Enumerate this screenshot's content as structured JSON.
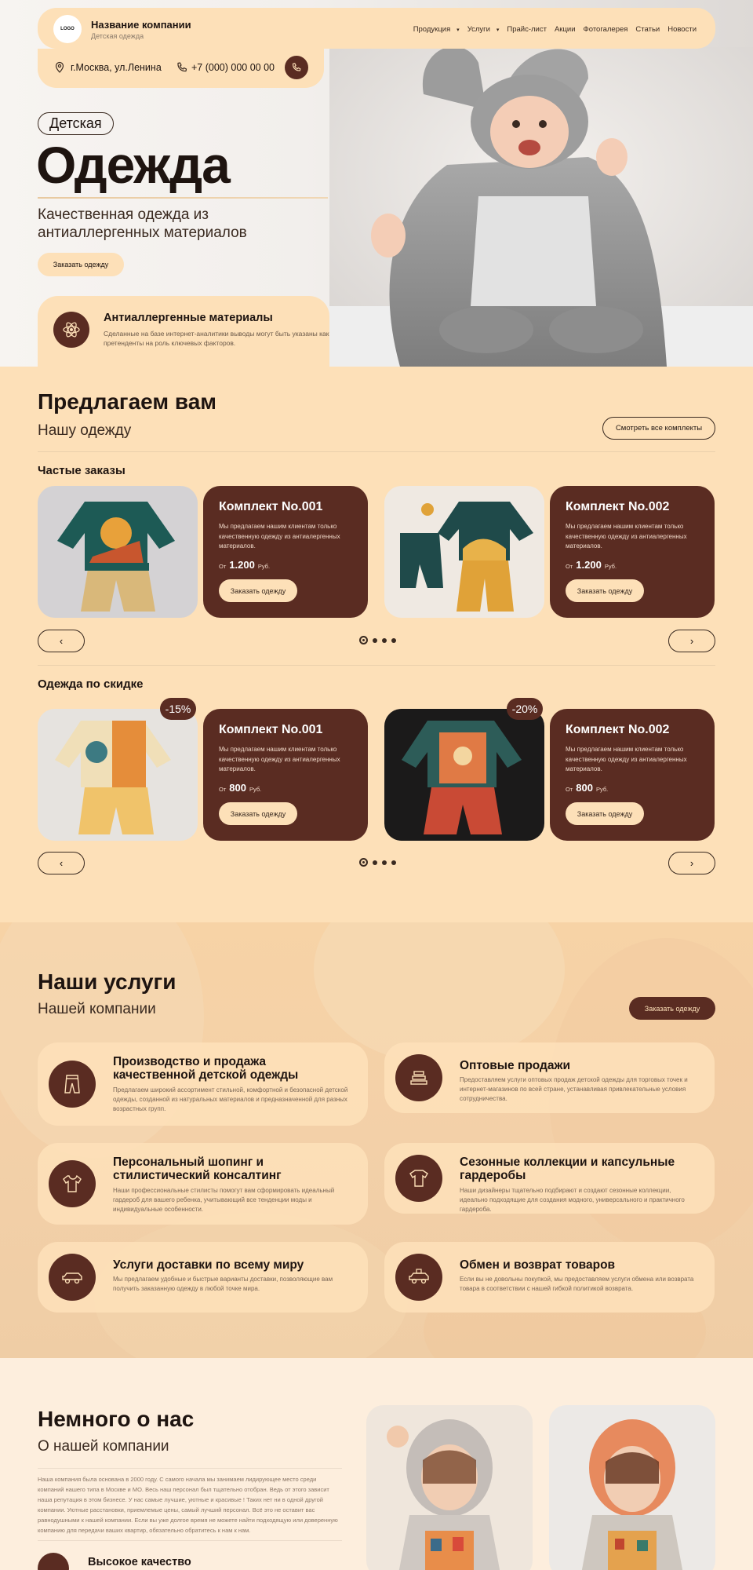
{
  "header": {
    "logo": "LOGO",
    "company": "Название компании",
    "tagline": "Детская одежда",
    "menu": [
      "Продукция",
      "Услуги",
      "Прайс-лист",
      "Акции",
      "Фотогалерея",
      "Статьи",
      "Новости"
    ],
    "address": "г.Москва, ул.Ленина",
    "phone": "+7 (000) 000 00 00"
  },
  "hero": {
    "badge": "Детская",
    "headline": "Одежда",
    "subtitle": "Качественная одежда из антиаллергенных материалов",
    "cta": "Заказать одежду",
    "feature_title": "Антиаллергенные материалы",
    "feature_text": "Сделанные на базе интернет-аналитики выводы могут быть указаны как претенденты на роль ключевых факторов."
  },
  "offers": {
    "title": "Предлагаем вам",
    "subtitle": "Нашу одежду",
    "view_all": "Смотреть все комплекты",
    "frequent": {
      "title": "Частые заказы",
      "items": [
        {
          "name": "Комплект No.001",
          "desc": "Мы предлагаем нашим клиентам только качественную одежду из антиалергенных материалов.",
          "from": "От",
          "price": "1.200",
          "currency": "Руб.",
          "button": "Заказать одежду"
        },
        {
          "name": "Комплект No.002",
          "desc": "Мы предлагаем нашим клиентам только качественную одежду из антиалергенных материалов.",
          "from": "От",
          "price": "1.200",
          "currency": "Руб.",
          "button": "Заказать одежду"
        }
      ]
    },
    "discount": {
      "title": "Одежда по скидке",
      "items": [
        {
          "badge": "-15%",
          "name": "Комплект No.001",
          "desc": "Мы предлагаем нашим клиентам только качественную одежду из антиалергенных материалов.",
          "from": "От",
          "price": "800",
          "currency": "Руб.",
          "button": "Заказать одежду"
        },
        {
          "badge": "-20%",
          "name": "Комплект No.002",
          "desc": "Мы предлагаем нашим клиентам только качественную одежду из антиалергенных материалов.",
          "from": "От",
          "price": "800",
          "currency": "Руб.",
          "button": "Заказать одежду"
        }
      ]
    },
    "prev": "‹",
    "next": "›"
  },
  "services": {
    "title": "Наши услуги",
    "subtitle": "Нашей компании",
    "cta": "Заказать одежду",
    "items": [
      {
        "icon": "pants-icon",
        "title": "Производство и продажа качественной детской одежды",
        "desc": "Предлагаем широкий ассортимент стильной, комфортной и безопасной детской одежды, созданной из натуральных материалов и предназначенной для разных возрастных групп."
      },
      {
        "icon": "stack-icon",
        "title": "Оптовые продажи",
        "desc": "Предоставляем услуги оптовых продаж детской одежды для торговых точек и интернет-магазинов по всей стране, устанавливая привлекательные условия сотрудничества."
      },
      {
        "icon": "bodysuit-icon",
        "title": "Персональный шопинг и стилистический консалтинг",
        "desc": "Наши профессиональные стилисты помогут вам сформировать идеальный гардероб для вашего ребенка, учитывающий все тенденции моды и индивидуальные особенности."
      },
      {
        "icon": "tshirt-icon",
        "title": "Сезонные коллекции и капсульные гардеробы",
        "desc": "Наши дизайнеры тщательно подбирают и создают сезонные коллекции, идеально подходящие для создания модного, универсального и практичного гардероба."
      },
      {
        "icon": "delivery-car-icon",
        "title": "Услуги доставки по всему миру",
        "desc": "Мы предлагаем удобные и быстрые варианты доставки, позволяющие вам получить заказанную одежду в любой точке мира."
      },
      {
        "icon": "return-car-icon",
        "title": "Обмен и возврат товаров",
        "desc": "Если вы не довольны покупкой, мы предоставляем услуги обмена или возврата товара в соответствии с нашей гибкой политикой возврата."
      }
    ]
  },
  "about": {
    "title": "Немного о нас",
    "subtitle": "О нашей компании",
    "text": "Наша компания была основана в 2000 году. С самого начала мы занимаем лидирующее место среди компаний нашего типа в Москве и МО. Весь наш персонал был тщательно отобран. Ведь от этого зависит наша репутация в этом бизнесе. У нас самые лучшие, уютные и красивые ! Таких нет ни в одной другой компании. Уютные расстановки, приемлемые цены, самый лучший персонал. Всё это не оставит вас равнодушными к нашей компании. Если вы уже долгое время не можете найти подходящую или доверенную компанию для передачи ваших квартир, обязательно обратитесь к нам к нам.",
    "feature": "Высокое качество"
  }
}
